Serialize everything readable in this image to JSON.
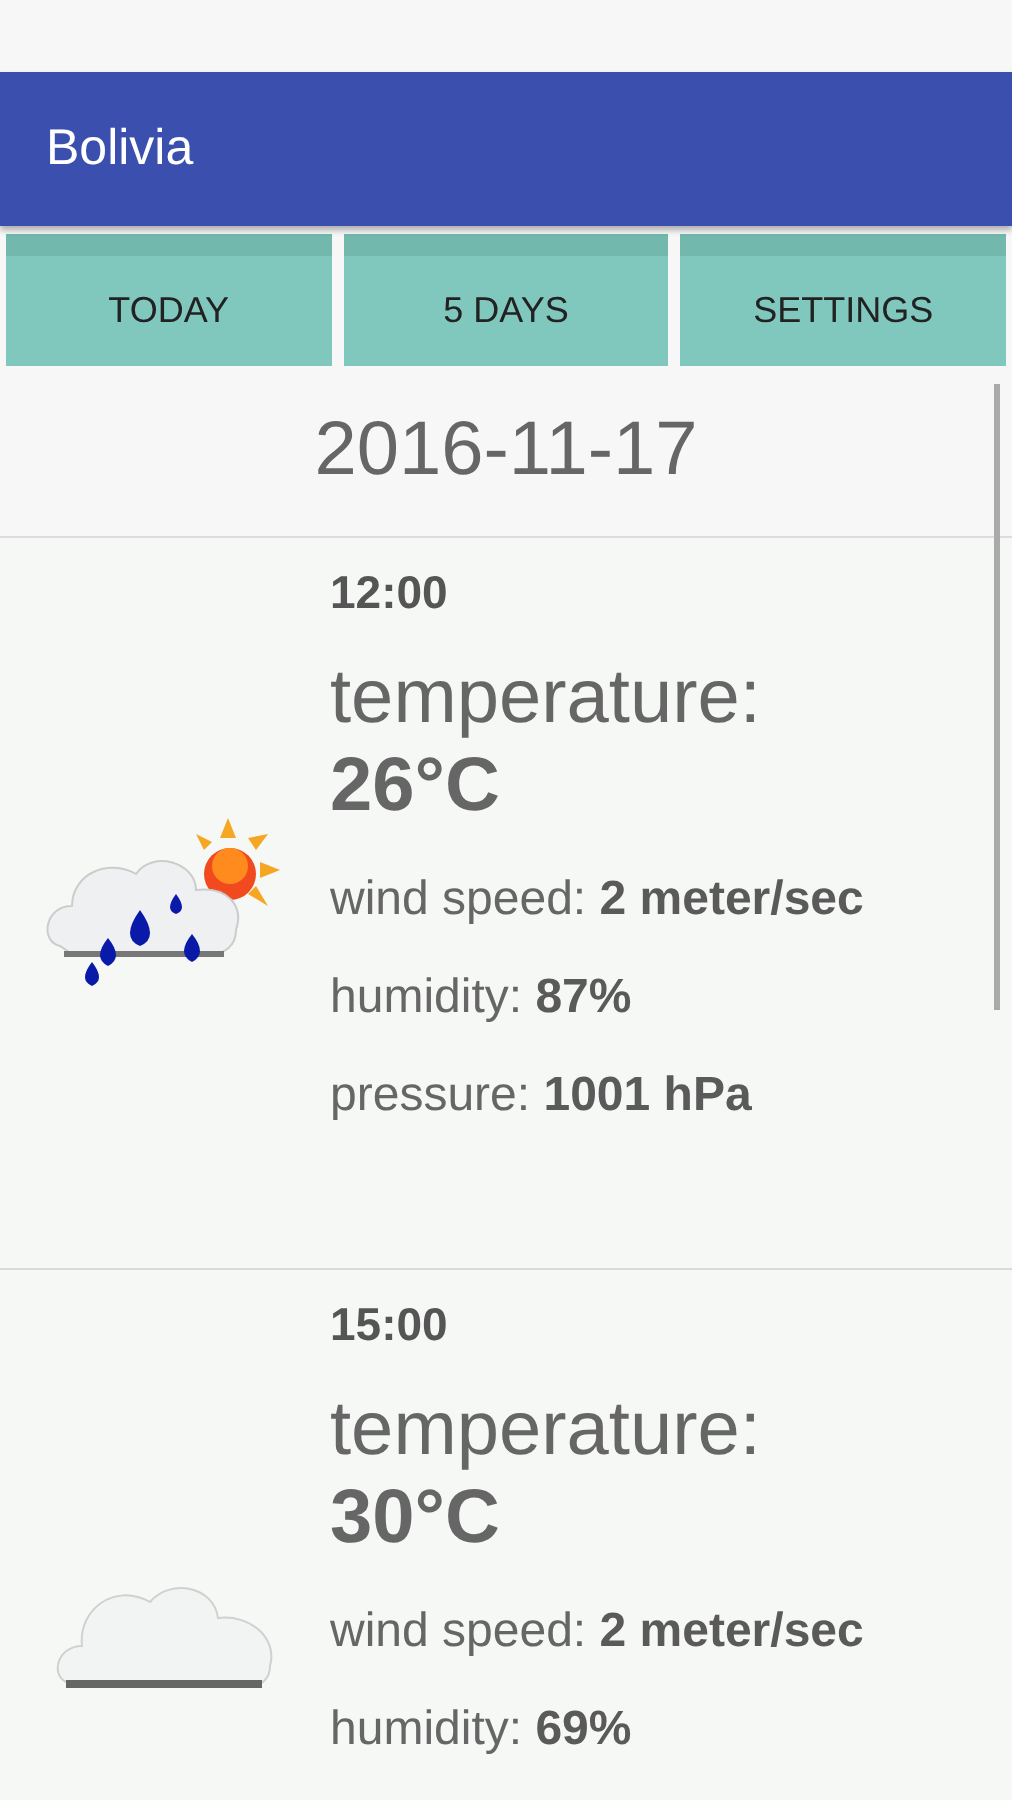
{
  "app_bar": {
    "title": "Bolivia"
  },
  "tabs": [
    {
      "label": "TODAY"
    },
    {
      "label": "5 DAYS"
    },
    {
      "label": "SETTINGS"
    }
  ],
  "date": "2016-11-17",
  "forecasts": [
    {
      "time": "12:00",
      "kind": "rain_sun",
      "temperature_label": "temperature:",
      "temperature": "26°C",
      "details": [
        "wind speed: **2 meter/sec**",
        "humidity: **87%**",
        "pressure: **1001 hPa**"
      ]
    },
    {
      "time": "15:00",
      "kind": "cloud",
      "temperature_label": "temperature:",
      "temperature": "30°C",
      "details": [
        "wind speed: **2 meter/sec**",
        "humidity: **69%**"
      ]
    }
  ]
}
